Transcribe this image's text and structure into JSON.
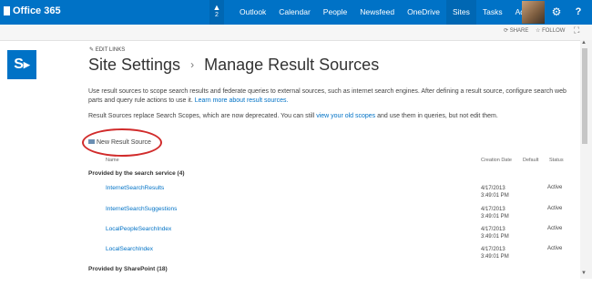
{
  "suitebar": {
    "brand": "Office 365",
    "notification_count": "2",
    "nav": [
      {
        "label": "Outlook"
      },
      {
        "label": "Calendar"
      },
      {
        "label": "People"
      },
      {
        "label": "Newsfeed"
      },
      {
        "label": "OneDrive"
      },
      {
        "label": "Sites"
      },
      {
        "label": "Tasks"
      },
      {
        "label": "Admin ▾"
      }
    ],
    "gear_icon": "⚙",
    "help_icon": "?",
    "accent_color": "#0072c6"
  },
  "subbar": {
    "share_label": "SHARE",
    "follow_label": "FOLLOW"
  },
  "header": {
    "edit_links": "EDIT LINKS",
    "title_part1": "Site Settings",
    "title_sep": "›",
    "title_part2": "Manage Result Sources"
  },
  "description": {
    "line1": "Use result sources to scope search results and federate queries to external sources, such as internet search engines. After defining a result source, configure search web parts and query rule actions to use it.",
    "learn_more": "Learn more about result sources.",
    "line2_before": "Result Sources replace Search Scopes, which are now deprecated. You can still ",
    "line2_link": "view your old scopes",
    "line2_after": " and use them in queries, but not edit them."
  },
  "actions": {
    "new_result_source": "New Result Source"
  },
  "table": {
    "headers": {
      "name": "Name",
      "creation_date": "Creation Date",
      "default": "Default",
      "status": "Status"
    },
    "groups": [
      {
        "title": "Provided by the search service (4)",
        "rows": [
          {
            "name": "InternetSearchResults",
            "date": "4/17/2013",
            "time": "3:49:01 PM",
            "status": "Active"
          },
          {
            "name": "InternetSearchSuggestions",
            "date": "4/17/2013",
            "time": "3:49:01 PM",
            "status": "Active"
          },
          {
            "name": "LocalPeopleSearchIndex",
            "date": "4/17/2013",
            "time": "3:49:01 PM",
            "status": "Active"
          },
          {
            "name": "LocalSearchIndex",
            "date": "4/17/2013",
            "time": "3:49:01 PM",
            "status": "Active"
          }
        ]
      },
      {
        "title": "Provided by SharePoint (18)",
        "rows": []
      }
    ]
  }
}
